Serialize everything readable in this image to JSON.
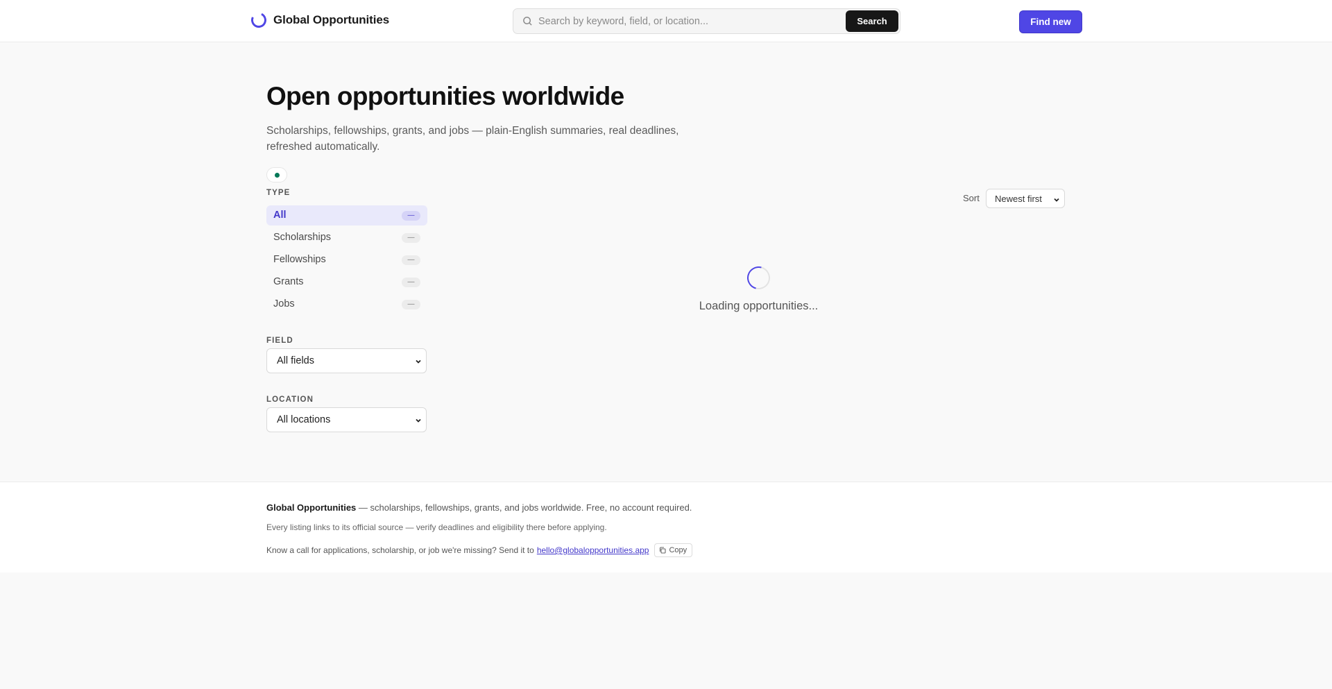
{
  "header": {
    "brand_name": "Global Opportunities",
    "search_placeholder": "Search by keyword, field, or location...",
    "search_button": "Search",
    "find_new_button": "Find new",
    "accent_color": "#4f46e5"
  },
  "hero": {
    "title": "Open opportunities worldwide",
    "subtitle": "Scholarships, fellowships, grants, and jobs — plain-English summaries, real deadlines, refreshed automatically.",
    "status_color": "#047857"
  },
  "filters": {
    "type_label": "TYPE",
    "types": [
      {
        "label": "All",
        "count": "—",
        "active": true
      },
      {
        "label": "Scholarships",
        "count": "—",
        "active": false
      },
      {
        "label": "Fellowships",
        "count": "—",
        "active": false
      },
      {
        "label": "Grants",
        "count": "—",
        "active": false
      },
      {
        "label": "Jobs",
        "count": "—",
        "active": false
      }
    ],
    "field_label": "FIELD",
    "field_value": "All fields",
    "location_label": "LOCATION",
    "location_value": "All locations"
  },
  "sort": {
    "label": "Sort",
    "value": "Newest first"
  },
  "results": {
    "loading_text": "Loading opportunities..."
  },
  "footer": {
    "brand": "Global Opportunities",
    "tagline": " — scholarships, fellowships, grants, and jobs worldwide. Free, no account required.",
    "disclaimer": "Every listing links to its official source — verify deadlines and eligibility there before applying.",
    "submit_text": "Know a call for applications, scholarship, or job we're missing? Send it to",
    "email": "hello@globalopportunities.app",
    "copy_label": "Copy"
  }
}
